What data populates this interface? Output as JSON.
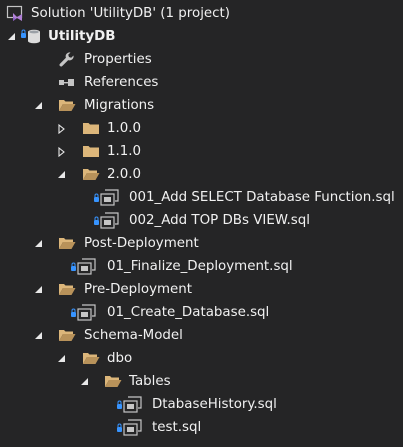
{
  "solution": {
    "label": "Solution 'UtilityDB' (1 project)"
  },
  "project": {
    "label": "UtilityDB"
  },
  "nodes": {
    "properties": "Properties",
    "references": "References",
    "migrations": "Migrations",
    "v100": "1.0.0",
    "v110": "1.1.0",
    "v200": "2.0.0",
    "file_001": "001_Add SELECT Database Function.sql",
    "file_002": "002_Add TOP DBs VIEW.sql",
    "post_deployment": "Post-Deployment",
    "finalize": "01_Finalize_Deployment.sql",
    "pre_deployment": "Pre-Deployment",
    "create_db": "01_Create_Database.sql",
    "schema_model": "Schema-Model",
    "dbo": "dbo",
    "tables": "Tables",
    "db_history": "DtabaseHistory.sql",
    "test": "test.sql"
  },
  "colors": {
    "background": "#252526",
    "text": "#f1f1f1",
    "folder": "#dcb67a",
    "vs_purple": "#b180d7",
    "lock_blue": "#3794ff"
  }
}
